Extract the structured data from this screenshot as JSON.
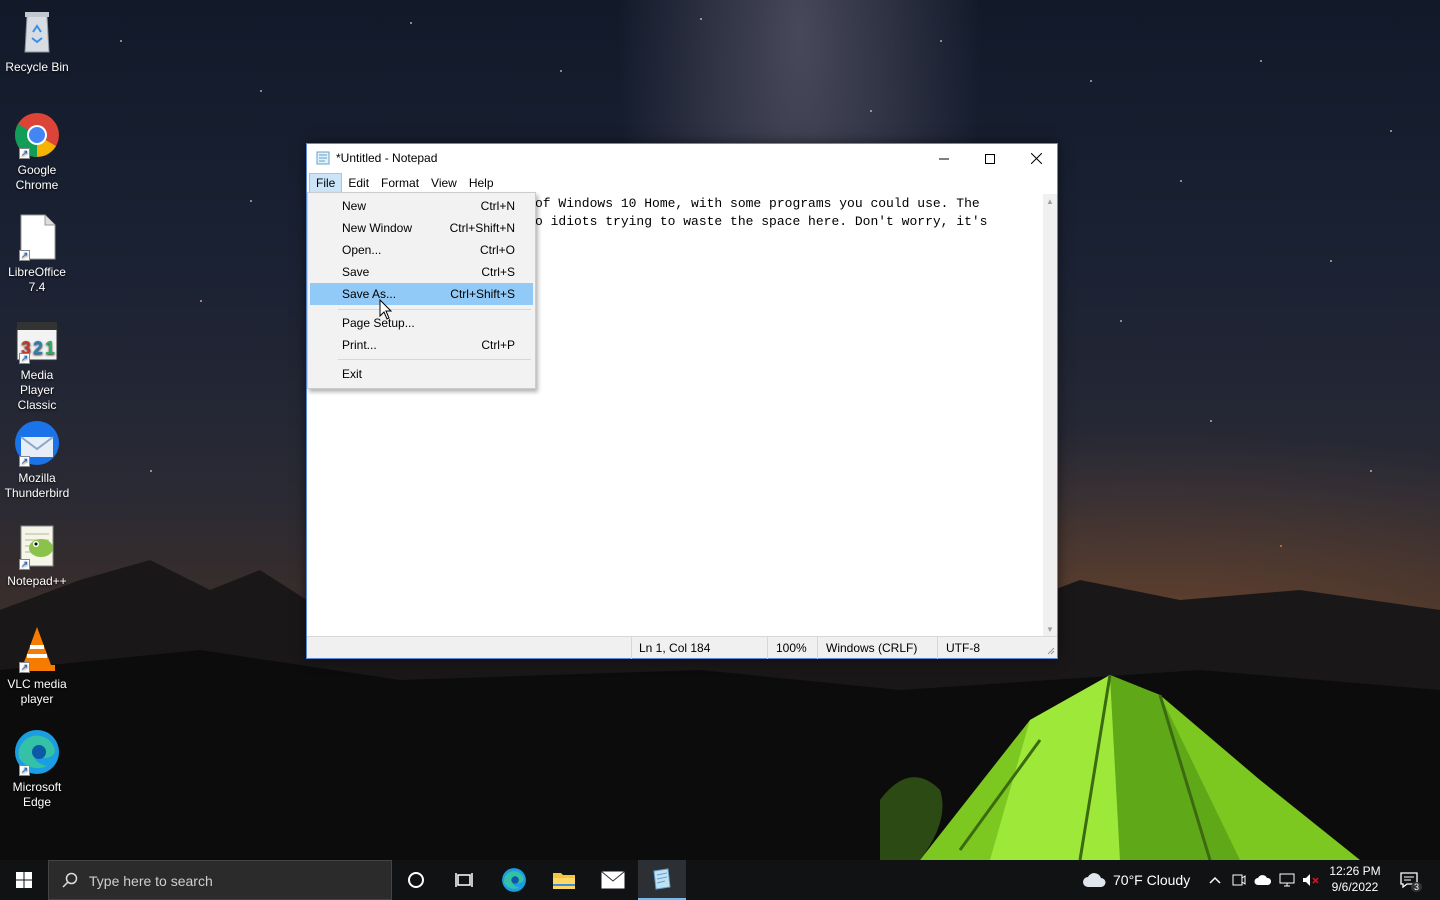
{
  "desktop": {
    "icons": [
      {
        "label": "Recycle Bin",
        "icon": "recycle-bin-icon"
      },
      {
        "label": "Google Chrome",
        "icon": "chrome-icon"
      },
      {
        "label": "LibreOffice 7.4",
        "icon": "libreoffice-icon"
      },
      {
        "label": "Media Player Classic",
        "icon": "media-player-classic-icon"
      },
      {
        "label": "Mozilla Thunderbird",
        "icon": "thunderbird-icon"
      },
      {
        "label": "Notepad++",
        "icon": "notepadpp-icon"
      },
      {
        "label": "VLC media player",
        "icon": "vlc-icon"
      },
      {
        "label": "Microsoft Edge",
        "icon": "edge-icon"
      }
    ]
  },
  "notepad": {
    "title": "*Untitled - Notepad",
    "menu": [
      "File",
      "Edit",
      "Format",
      "View",
      "Help"
    ],
    "editor_lines": [
      "of Windows 10 Home, with some programs you could use. The",
      "o idiots trying to waste the space here. Don't worry, it's"
    ],
    "status": {
      "position": "Ln 1, Col 184",
      "zoom": "100%",
      "line_ending": "Windows (CRLF)",
      "encoding": "UTF-8"
    }
  },
  "file_menu": {
    "items": [
      {
        "label": "New",
        "shortcut": "Ctrl+N"
      },
      {
        "label": "New Window",
        "shortcut": "Ctrl+Shift+N"
      },
      {
        "label": "Open...",
        "shortcut": "Ctrl+O"
      },
      {
        "label": "Save",
        "shortcut": "Ctrl+S"
      },
      {
        "label": "Save As...",
        "shortcut": "Ctrl+Shift+S"
      },
      {
        "label": "Page Setup...",
        "shortcut": ""
      },
      {
        "label": "Print...",
        "shortcut": "Ctrl+P"
      },
      {
        "label": "Exit",
        "shortcut": ""
      }
    ],
    "highlighted": "Save As..."
  },
  "taskbar": {
    "search_placeholder": "Type here to search",
    "weather": "70°F  Cloudy",
    "time": "12:26 PM",
    "date": "9/6/2022",
    "notification_count": "3"
  },
  "colors": {
    "menu_highlight": "#91c9f7",
    "menu_active": "#cce4f7",
    "taskbar": "#101214"
  }
}
